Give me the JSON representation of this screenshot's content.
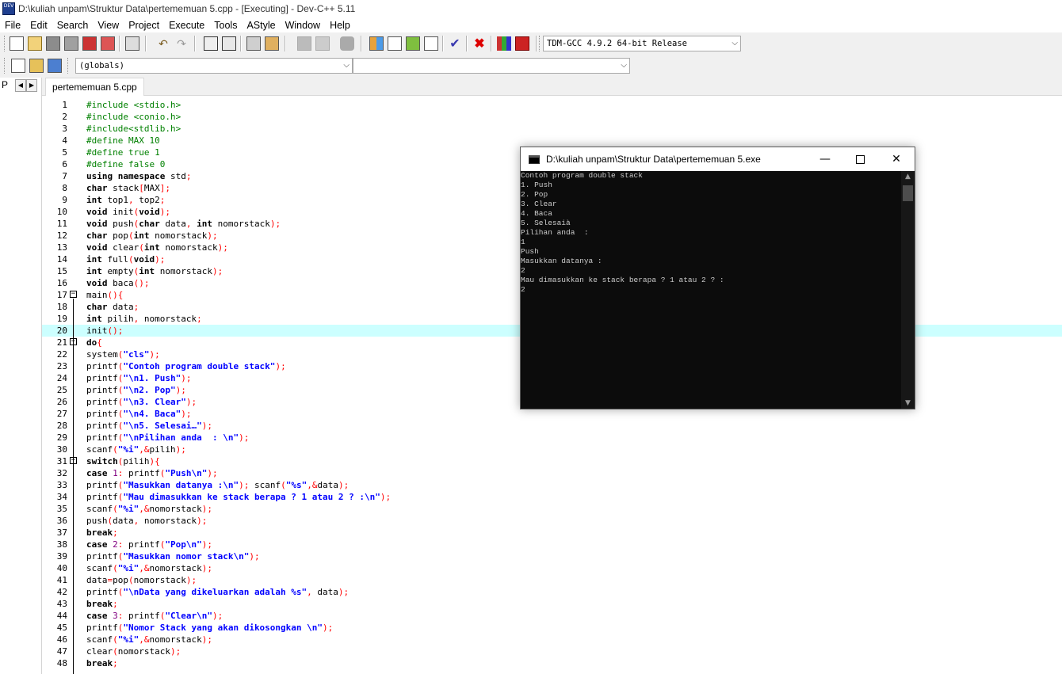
{
  "window": {
    "title": "D:\\kuliah unpam\\Struktur Data\\pertememuan 5.cpp - [Executing] - Dev-C++ 5.11",
    "icon_label": "DEV"
  },
  "menu": [
    "File",
    "Edit",
    "Search",
    "View",
    "Project",
    "Execute",
    "Tools",
    "AStyle",
    "Window",
    "Help"
  ],
  "toolbar": {
    "compiler": "TDM-GCC 4.9.2 64-bit Release",
    "scope": "(globals)",
    "member": ""
  },
  "left_panel": {
    "tab_label": "P"
  },
  "editor": {
    "tab": "pertememuan 5.cpp",
    "highlighted_line": 20,
    "lines": [
      {
        "n": "1",
        "t": "#include <stdio.h>"
      },
      {
        "n": "2",
        "t": "#include <conio.h>"
      },
      {
        "n": "3",
        "t": "#include<stdlib.h>"
      },
      {
        "n": "4",
        "t": "#define MAX 10"
      },
      {
        "n": "5",
        "t": "#define true 1"
      },
      {
        "n": "6",
        "t": "#define false 0"
      },
      {
        "n": "7",
        "t": "using namespace std;"
      },
      {
        "n": "8",
        "t": "char stack[MAX];"
      },
      {
        "n": "9",
        "t": "int top1, top2;"
      },
      {
        "n": "10",
        "t": "void init(void);"
      },
      {
        "n": "11",
        "t": "void push(char data, int nomorstack);"
      },
      {
        "n": "12",
        "t": "char pop(int nomorstack);"
      },
      {
        "n": "13",
        "t": "void clear(int nomorstack);"
      },
      {
        "n": "14",
        "t": "int full(void);"
      },
      {
        "n": "15",
        "t": "int empty(int nomorstack);"
      },
      {
        "n": "16",
        "t": "void baca();"
      },
      {
        "n": "17",
        "t": "main(){"
      },
      {
        "n": "18",
        "t": "char data;"
      },
      {
        "n": "19",
        "t": "int pilih, nomorstack;"
      },
      {
        "n": "20",
        "t": "init();"
      },
      {
        "n": "21",
        "t": "do{"
      },
      {
        "n": "22",
        "t": "system(\"cls\");"
      },
      {
        "n": "23",
        "t": "printf(\"Contoh program double stack\");"
      },
      {
        "n": "24",
        "t": "printf(\"\\n1. Push\");"
      },
      {
        "n": "25",
        "t": "printf(\"\\n2. Pop\");"
      },
      {
        "n": "26",
        "t": "printf(\"\\n3. Clear\");"
      },
      {
        "n": "27",
        "t": "printf(\"\\n4. Baca\");"
      },
      {
        "n": "28",
        "t": "printf(\"\\n5. Selesai…\");"
      },
      {
        "n": "29",
        "t": "printf(\"\\nPilihan anda  : \\n\");"
      },
      {
        "n": "30",
        "t": "scanf(\"%i\",&pilih);"
      },
      {
        "n": "31",
        "t": "switch(pilih){"
      },
      {
        "n": "32",
        "t": "case 1: printf(\"Push\\n\");"
      },
      {
        "n": "33",
        "t": "printf(\"Masukkan datanya :\\n\"); scanf(\"%s\",&data);"
      },
      {
        "n": "34",
        "t": "printf(\"Mau dimasukkan ke stack berapa ? 1 atau 2 ? :\\n\");"
      },
      {
        "n": "35",
        "t": "scanf(\"%i\",&nomorstack);"
      },
      {
        "n": "36",
        "t": "push(data, nomorstack);"
      },
      {
        "n": "37",
        "t": "break;"
      },
      {
        "n": "38",
        "t": "case 2: printf(\"Pop\\n\");"
      },
      {
        "n": "39",
        "t": "printf(\"Masukkan nomor stack\\n\");"
      },
      {
        "n": "40",
        "t": "scanf(\"%i\",&nomorstack);"
      },
      {
        "n": "41",
        "t": "data=pop(nomorstack);"
      },
      {
        "n": "42",
        "t": "printf(\"\\nData yang dikeluarkan adalah %s\", data);"
      },
      {
        "n": "43",
        "t": "break;"
      },
      {
        "n": "44",
        "t": "case 3: printf(\"Clear\\n\");"
      },
      {
        "n": "45",
        "t": "printf(\"Nomor Stack yang akan dikosongkan \\n\");"
      },
      {
        "n": "46",
        "t": "scanf(\"%i\",&nomorstack);"
      },
      {
        "n": "47",
        "t": "clear(nomorstack);"
      },
      {
        "n": "48",
        "t": "break;"
      }
    ],
    "folds": [
      "17",
      "21",
      "31"
    ]
  },
  "console": {
    "title": "D:\\kuliah unpam\\Struktur Data\\pertememuan 5.exe",
    "output": [
      "Contoh program double stack",
      "1. Push",
      "2. Pop",
      "3. Clear",
      "4. Baca",
      "5. Selesaià",
      "Pilihan anda  :",
      "1",
      "Push",
      "Masukkan datanya :",
      "2",
      "Mau dimasukkan ke stack berapa ? 1 atau 2 ? :",
      "2"
    ]
  },
  "colors": {
    "directive": "#008000",
    "keyword": "#000000",
    "string": "#0000ff",
    "symbol": "#ff0000",
    "number": "#800080",
    "highlight": "#ccffff",
    "console_bg": "#0c0c0c",
    "console_text": "#cccccc"
  },
  "icons": [
    "new-file-icon",
    "open-icon",
    "save-icon",
    "save-all-icon",
    "close-icon",
    "close-all-icon",
    "print-icon",
    "undo-icon",
    "redo-icon",
    "find-icon",
    "replace-icon",
    "indent-icon",
    "unindent-icon",
    "goto-back-icon",
    "goto-forward-icon",
    "bookmark-icon",
    "new-project-icon",
    "options-icon",
    "compile-run-icon",
    "layout-icon",
    "check-icon",
    "stop-icon",
    "chart-icon",
    "debug-icon"
  ]
}
